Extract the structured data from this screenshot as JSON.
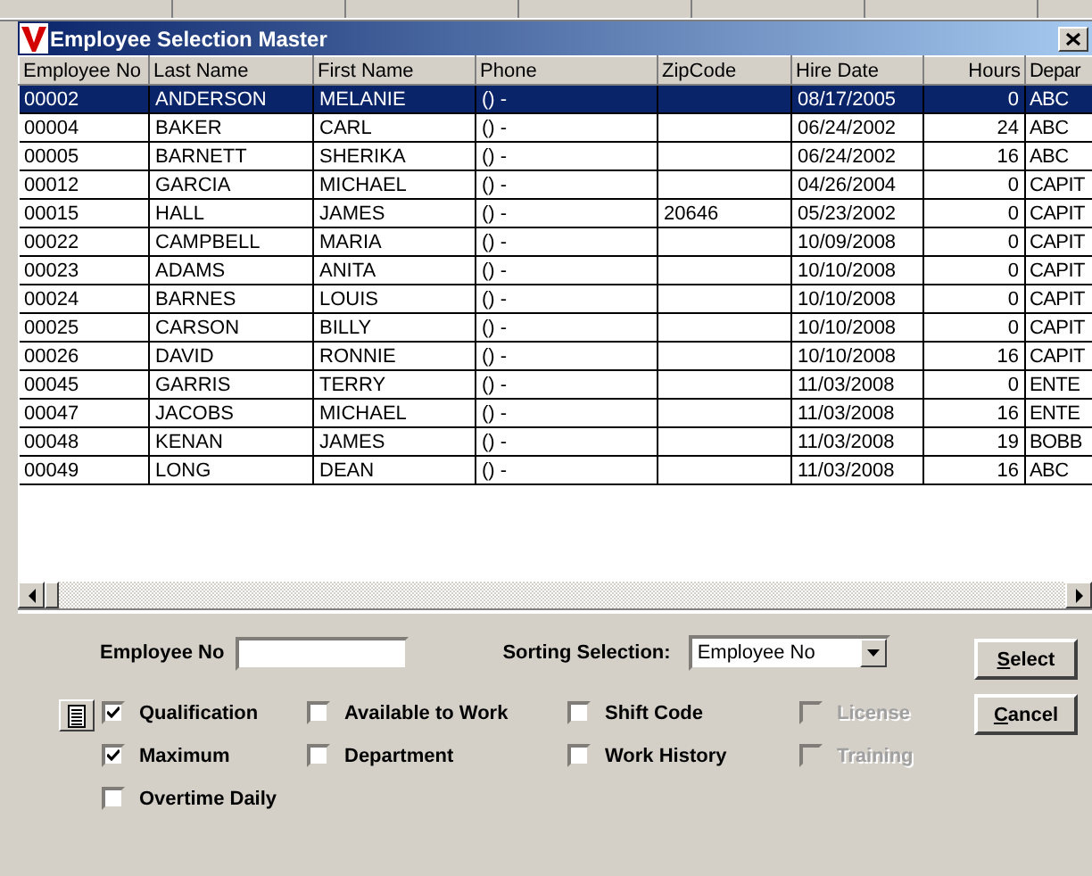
{
  "window": {
    "title": "Employee Selection Master"
  },
  "table": {
    "columns": [
      {
        "label": "Employee No"
      },
      {
        "label": "Last Name"
      },
      {
        "label": "First Name"
      },
      {
        "label": "Phone"
      },
      {
        "label": "ZipCode"
      },
      {
        "label": "Hire Date"
      },
      {
        "label": "Hours"
      },
      {
        "label": "Depar"
      }
    ],
    "rows": [
      {
        "selected": true,
        "cells": [
          "00002",
          "ANDERSON",
          "MELANIE",
          "() -",
          "",
          "08/17/2005",
          "0",
          "ABC"
        ]
      },
      {
        "selected": false,
        "cells": [
          "00004",
          "BAKER",
          "CARL",
          "() -",
          "",
          "06/24/2002",
          "24",
          "ABC"
        ]
      },
      {
        "selected": false,
        "cells": [
          "00005",
          "BARNETT",
          "SHERIKA",
          "() -",
          "",
          "06/24/2002",
          "16",
          "ABC"
        ]
      },
      {
        "selected": false,
        "cells": [
          "00012",
          "GARCIA",
          "MICHAEL",
          "() -",
          "",
          "04/26/2004",
          "0",
          "CAPIT"
        ]
      },
      {
        "selected": false,
        "cells": [
          "00015",
          "HALL",
          "JAMES",
          "() -",
          "20646",
          "05/23/2002",
          "0",
          "CAPIT"
        ]
      },
      {
        "selected": false,
        "cells": [
          "00022",
          "CAMPBELL",
          "MARIA",
          "() -",
          "",
          "10/09/2008",
          "0",
          "CAPIT"
        ]
      },
      {
        "selected": false,
        "cells": [
          "00023",
          "ADAMS",
          "ANITA",
          "() -",
          "",
          "10/10/2008",
          "0",
          "CAPIT"
        ]
      },
      {
        "selected": false,
        "cells": [
          "00024",
          "BARNES",
          "LOUIS",
          "() -",
          "",
          "10/10/2008",
          "0",
          "CAPIT"
        ]
      },
      {
        "selected": false,
        "cells": [
          "00025",
          "CARSON",
          "BILLY",
          "() -",
          "",
          "10/10/2008",
          "0",
          "CAPIT"
        ]
      },
      {
        "selected": false,
        "cells": [
          "00026",
          "DAVID",
          "RONNIE",
          "() -",
          "",
          "10/10/2008",
          "16",
          "CAPIT"
        ]
      },
      {
        "selected": false,
        "cells": [
          "00045",
          "GARRIS",
          "TERRY",
          "() -",
          "",
          "11/03/2008",
          "0",
          "ENTE"
        ]
      },
      {
        "selected": false,
        "cells": [
          "00047",
          "JACOBS",
          "MICHAEL",
          "() -",
          "",
          "11/03/2008",
          "16",
          "ENTE"
        ]
      },
      {
        "selected": false,
        "cells": [
          "00048",
          "KENAN",
          "JAMES",
          "() -",
          "",
          "11/03/2008",
          "19",
          "BOBB"
        ]
      },
      {
        "selected": false,
        "cells": [
          "00049",
          "LONG",
          "DEAN",
          "() -",
          "",
          "11/03/2008",
          "16",
          "ABC"
        ]
      }
    ]
  },
  "filters": {
    "employee_no": {
      "label": "Employee No"
    },
    "sorting": {
      "label": "Sorting Selection:",
      "value": "Employee No"
    },
    "options": [
      {
        "label": "Qualification",
        "checked": true,
        "disabled": false
      },
      {
        "label": "Available to Work",
        "checked": false,
        "disabled": false
      },
      {
        "label": "Shift Code",
        "checked": false,
        "disabled": false
      },
      {
        "label": "License",
        "checked": false,
        "disabled": true
      },
      {
        "label": "Maximum",
        "checked": true,
        "disabled": false
      },
      {
        "label": "Department",
        "checked": false,
        "disabled": false
      },
      {
        "label": "Work History",
        "checked": false,
        "disabled": false
      },
      {
        "label": "Training",
        "checked": false,
        "disabled": true
      },
      {
        "label": "Overtime Daily",
        "checked": false,
        "disabled": false
      }
    ]
  },
  "buttons": [
    {
      "label": "Select"
    },
    {
      "label": "Cancel"
    }
  ]
}
